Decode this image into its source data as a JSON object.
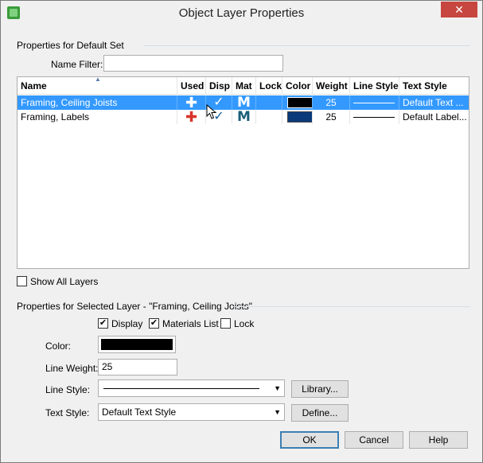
{
  "window": {
    "title": "Object Layer Properties",
    "close_glyph": "✕"
  },
  "default_set": {
    "group_label": "Properties for Default Set",
    "name_filter_label": "Name Filter:",
    "name_filter_value": ""
  },
  "table": {
    "columns": [
      "Name",
      "Used",
      "Disp",
      "Mat",
      "Lock",
      "Color",
      "Weight",
      "Line Style",
      "Text Style"
    ],
    "rows": [
      {
        "name": "Framing, Ceiling Joists",
        "used": "✚",
        "disp": "✓",
        "mat": "M",
        "lock": "",
        "color": "#000000",
        "weight": "25",
        "text_style": "Default Text ...",
        "selected": true
      },
      {
        "name": "Framing, Labels",
        "used": "✚",
        "disp": "✓",
        "mat": "M",
        "lock": "",
        "color": "#0a3a7a",
        "weight": "25",
        "text_style": "Default Label...",
        "selected": false
      }
    ]
  },
  "show_all_layers": {
    "label": "Show All Layers",
    "checked": false
  },
  "selected_layer": {
    "group_label": "Properties for Selected Layer - \"Framing, Ceiling Joists\"",
    "display": {
      "label": "Display",
      "checked": true
    },
    "materials_list": {
      "label": "Materials List",
      "checked": true
    },
    "lock": {
      "label": "Lock",
      "checked": false
    },
    "color_label": "Color:",
    "color_value": "#000000",
    "line_weight_label": "Line Weight:",
    "line_weight_value": "25",
    "line_style_label": "Line Style:",
    "library_button": "Library...",
    "text_style_label": "Text Style:",
    "text_style_value": "Default Text Style",
    "define_button": "Define..."
  },
  "buttons": {
    "ok": "OK",
    "cancel": "Cancel",
    "help": "Help"
  },
  "colors": {
    "selection": "#3399ff",
    "used_plus_red": "#d9342b",
    "check_blue": "#1a5f9e",
    "mat_teal": "#1a5f7a"
  }
}
